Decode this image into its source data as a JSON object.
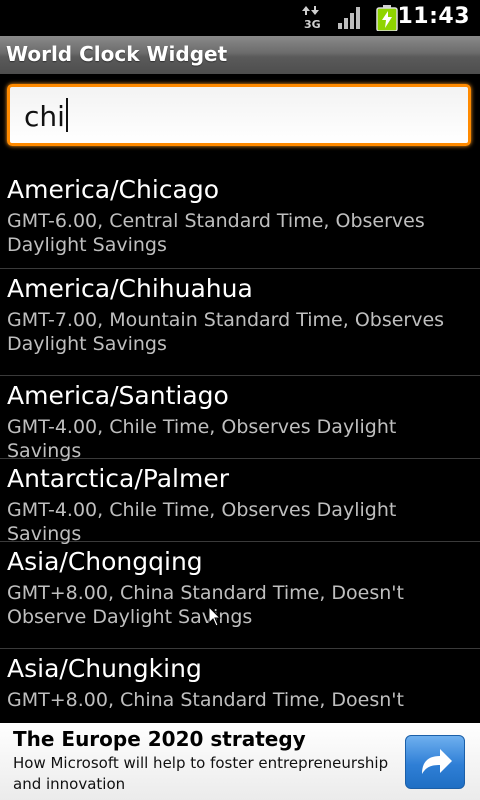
{
  "status_bar": {
    "network": "3G",
    "time": "11:43"
  },
  "app_title": "World Clock Widget",
  "search": {
    "value": "chi"
  },
  "timezones": [
    {
      "name": "America/Chicago",
      "description": "GMT-6.00, Central Standard Time, Observes Daylight Savings"
    },
    {
      "name": "America/Chihuahua",
      "description": "GMT-7.00, Mountain Standard Time, Observes Daylight Savings"
    },
    {
      "name": "America/Santiago",
      "description": "GMT-4.00, Chile Time, Observes Daylight Savings"
    },
    {
      "name": "Antarctica/Palmer",
      "description": "GMT-4.00, Chile Time, Observes Daylight Savings"
    },
    {
      "name": "Asia/Chongqing",
      "description": "GMT+8.00, China Standard Time, Doesn't Observe Daylight Savings"
    },
    {
      "name": "Asia/Chungking",
      "description": "GMT+8.00, China Standard Time, Doesn't"
    }
  ],
  "ad": {
    "title": "The Europe 2020 strategy",
    "subtitle": "How Microsoft will help to foster entrepreneurship and innovation",
    "button_icon": "share-arrow-icon"
  },
  "colors": {
    "accent_focus": "#ff8a00",
    "title_bar": "#6b6b6b",
    "battery": "#8fd400",
    "ad_button": "#2f7fd6"
  }
}
